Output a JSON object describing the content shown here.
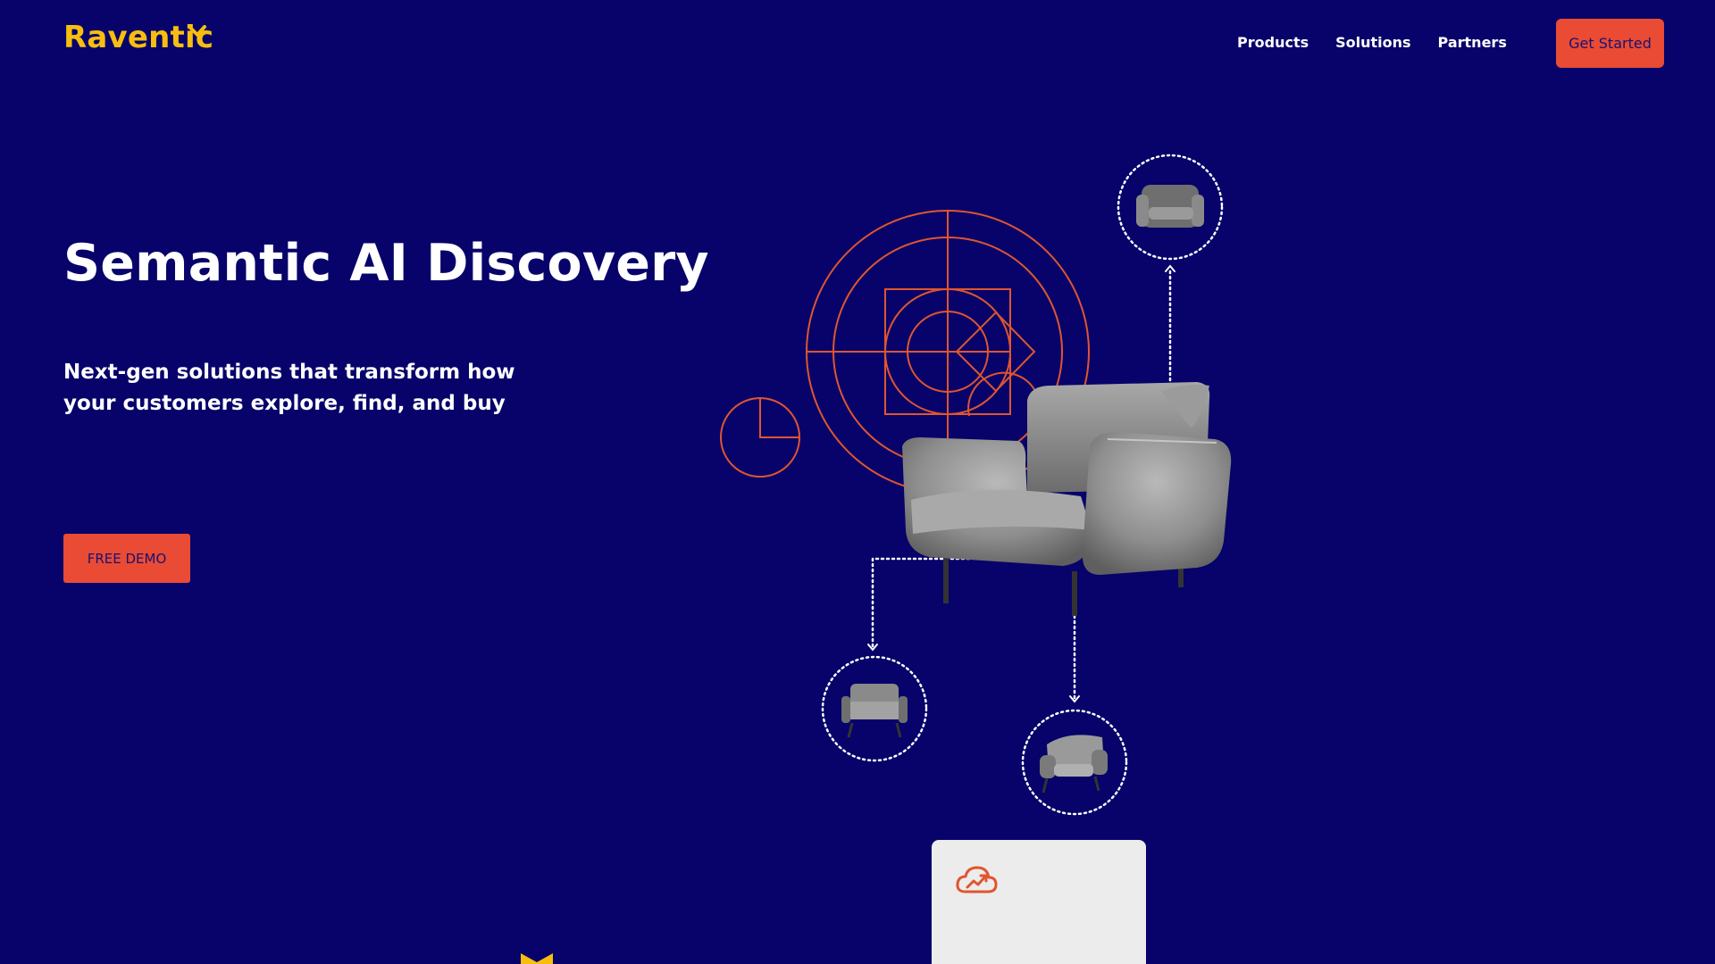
{
  "header": {
    "logo_text": "Raventic",
    "nav": [
      {
        "label": "Products"
      },
      {
        "label": "Solutions"
      },
      {
        "label": "Partners"
      }
    ],
    "cta_label": "Get Started"
  },
  "hero": {
    "title": "Semantic AI Discovery",
    "subtitle": "Next-gen solutions that transform how your customers explore, find, and buy",
    "demo_label": "FREE DEMO"
  },
  "illustration": {
    "main_product": "armchair-image",
    "related_products": [
      "armchair-image",
      "armchair-image",
      "armchair-image"
    ]
  },
  "card": {
    "icon": "cloud-growth-icon"
  },
  "colors": {
    "background": "#07036a",
    "accent": "#e94b35",
    "brand": "#f7be0f",
    "button_text": "#1b116e",
    "card_bg": "#ececec"
  }
}
